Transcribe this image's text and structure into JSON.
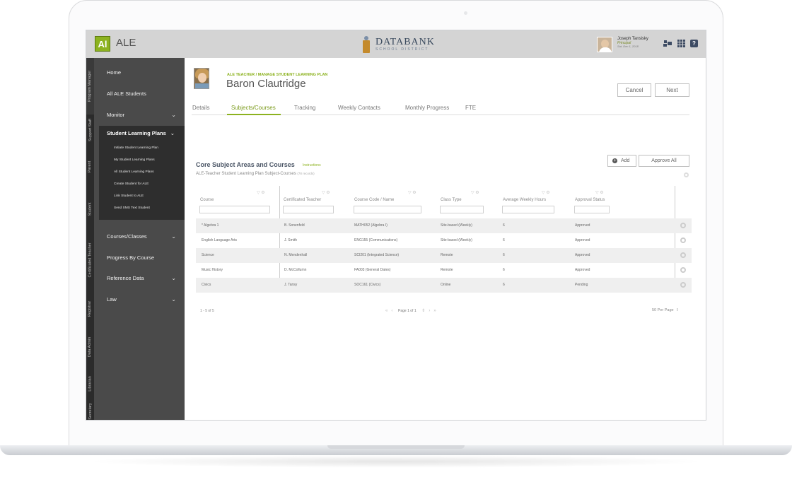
{
  "app": {
    "logo_letters": "Al",
    "name": "ALE"
  },
  "district_logo": {
    "title": "DATABANK",
    "subtitle": "SCHOOL DISTRICT"
  },
  "user": {
    "name": "Joseph Tansisky",
    "role": "Principal",
    "date": "Sat. Dec 1, 2018"
  },
  "vertical_tabs": [
    "Program Manager",
    "Support Staff",
    "Parent",
    "Student",
    "Certificated Teacher",
    "Registrar",
    "Data Admin",
    "Librarian",
    "Secretary"
  ],
  "nav": {
    "home": "Home",
    "all_students": "All ALE Students",
    "monitor": "Monitor",
    "slp_title": "Student Learning Plans",
    "slp_items": [
      "Initiate Student Learning Plan",
      "My Student Learning Plans",
      "All Student Learning Plans",
      "Create Student for ALE",
      "Link Student to ALE",
      "Send SMS Text Student"
    ],
    "courses_classes": "Courses/Classes",
    "progress_by_course": "Progress By Course",
    "reference_data": "Reference Data",
    "law": "Law"
  },
  "header": {
    "breadcrumb": "ALE TEACHER / MANAGE STUDENT LEARNING PLAN",
    "student_name": "Baron Clautridge",
    "cancel_label": "Cancel",
    "next_label": "Next"
  },
  "tabs": [
    "Details",
    "Subjects/Courses",
    "Tracking",
    "Weekly Contacts",
    "Monthly Progress",
    "FTE"
  ],
  "active_tab": "Subjects/Courses",
  "section": {
    "title": "Core Subject Areas and Courses",
    "instructions": "Instructions",
    "subtitle": "ALE-Teacher Student Learning Plan Subject-Courses",
    "record_count": "(78 records)",
    "add_label": "Add",
    "approve_all_label": "Approve All"
  },
  "table": {
    "columns": [
      "Course",
      "Certificated Teacher",
      "Course Code / Name",
      "Class Type",
      "Average Weekly Hours",
      "Approval Status"
    ],
    "rows": [
      [
        "* Algebra 1",
        "B. Sonenfeld",
        "MATH052 (Algebra I)",
        "Site-based (Weekly)",
        "6",
        "Approved"
      ],
      [
        "English Language Arts",
        "J. Smith",
        "ENG155 (Communications)",
        "Site-based (Weekly)",
        "6",
        "Approved"
      ],
      [
        "Science",
        "N. Mendenhall",
        "SCI201 (Integrated Science)",
        "Remote",
        "6",
        "Approved"
      ],
      [
        "Music History",
        "D. McCollumn",
        "FA003 (General Dates)",
        "Remote",
        "6",
        "Approved"
      ],
      [
        "Civics",
        "J. Tansy",
        "SOC161 (Civics)",
        "Online",
        "6",
        "Pending"
      ]
    ]
  },
  "pager": {
    "range": "1 - 5 of 5",
    "page_text": "Page 1 of 1",
    "per_page": "50 Per Page"
  }
}
